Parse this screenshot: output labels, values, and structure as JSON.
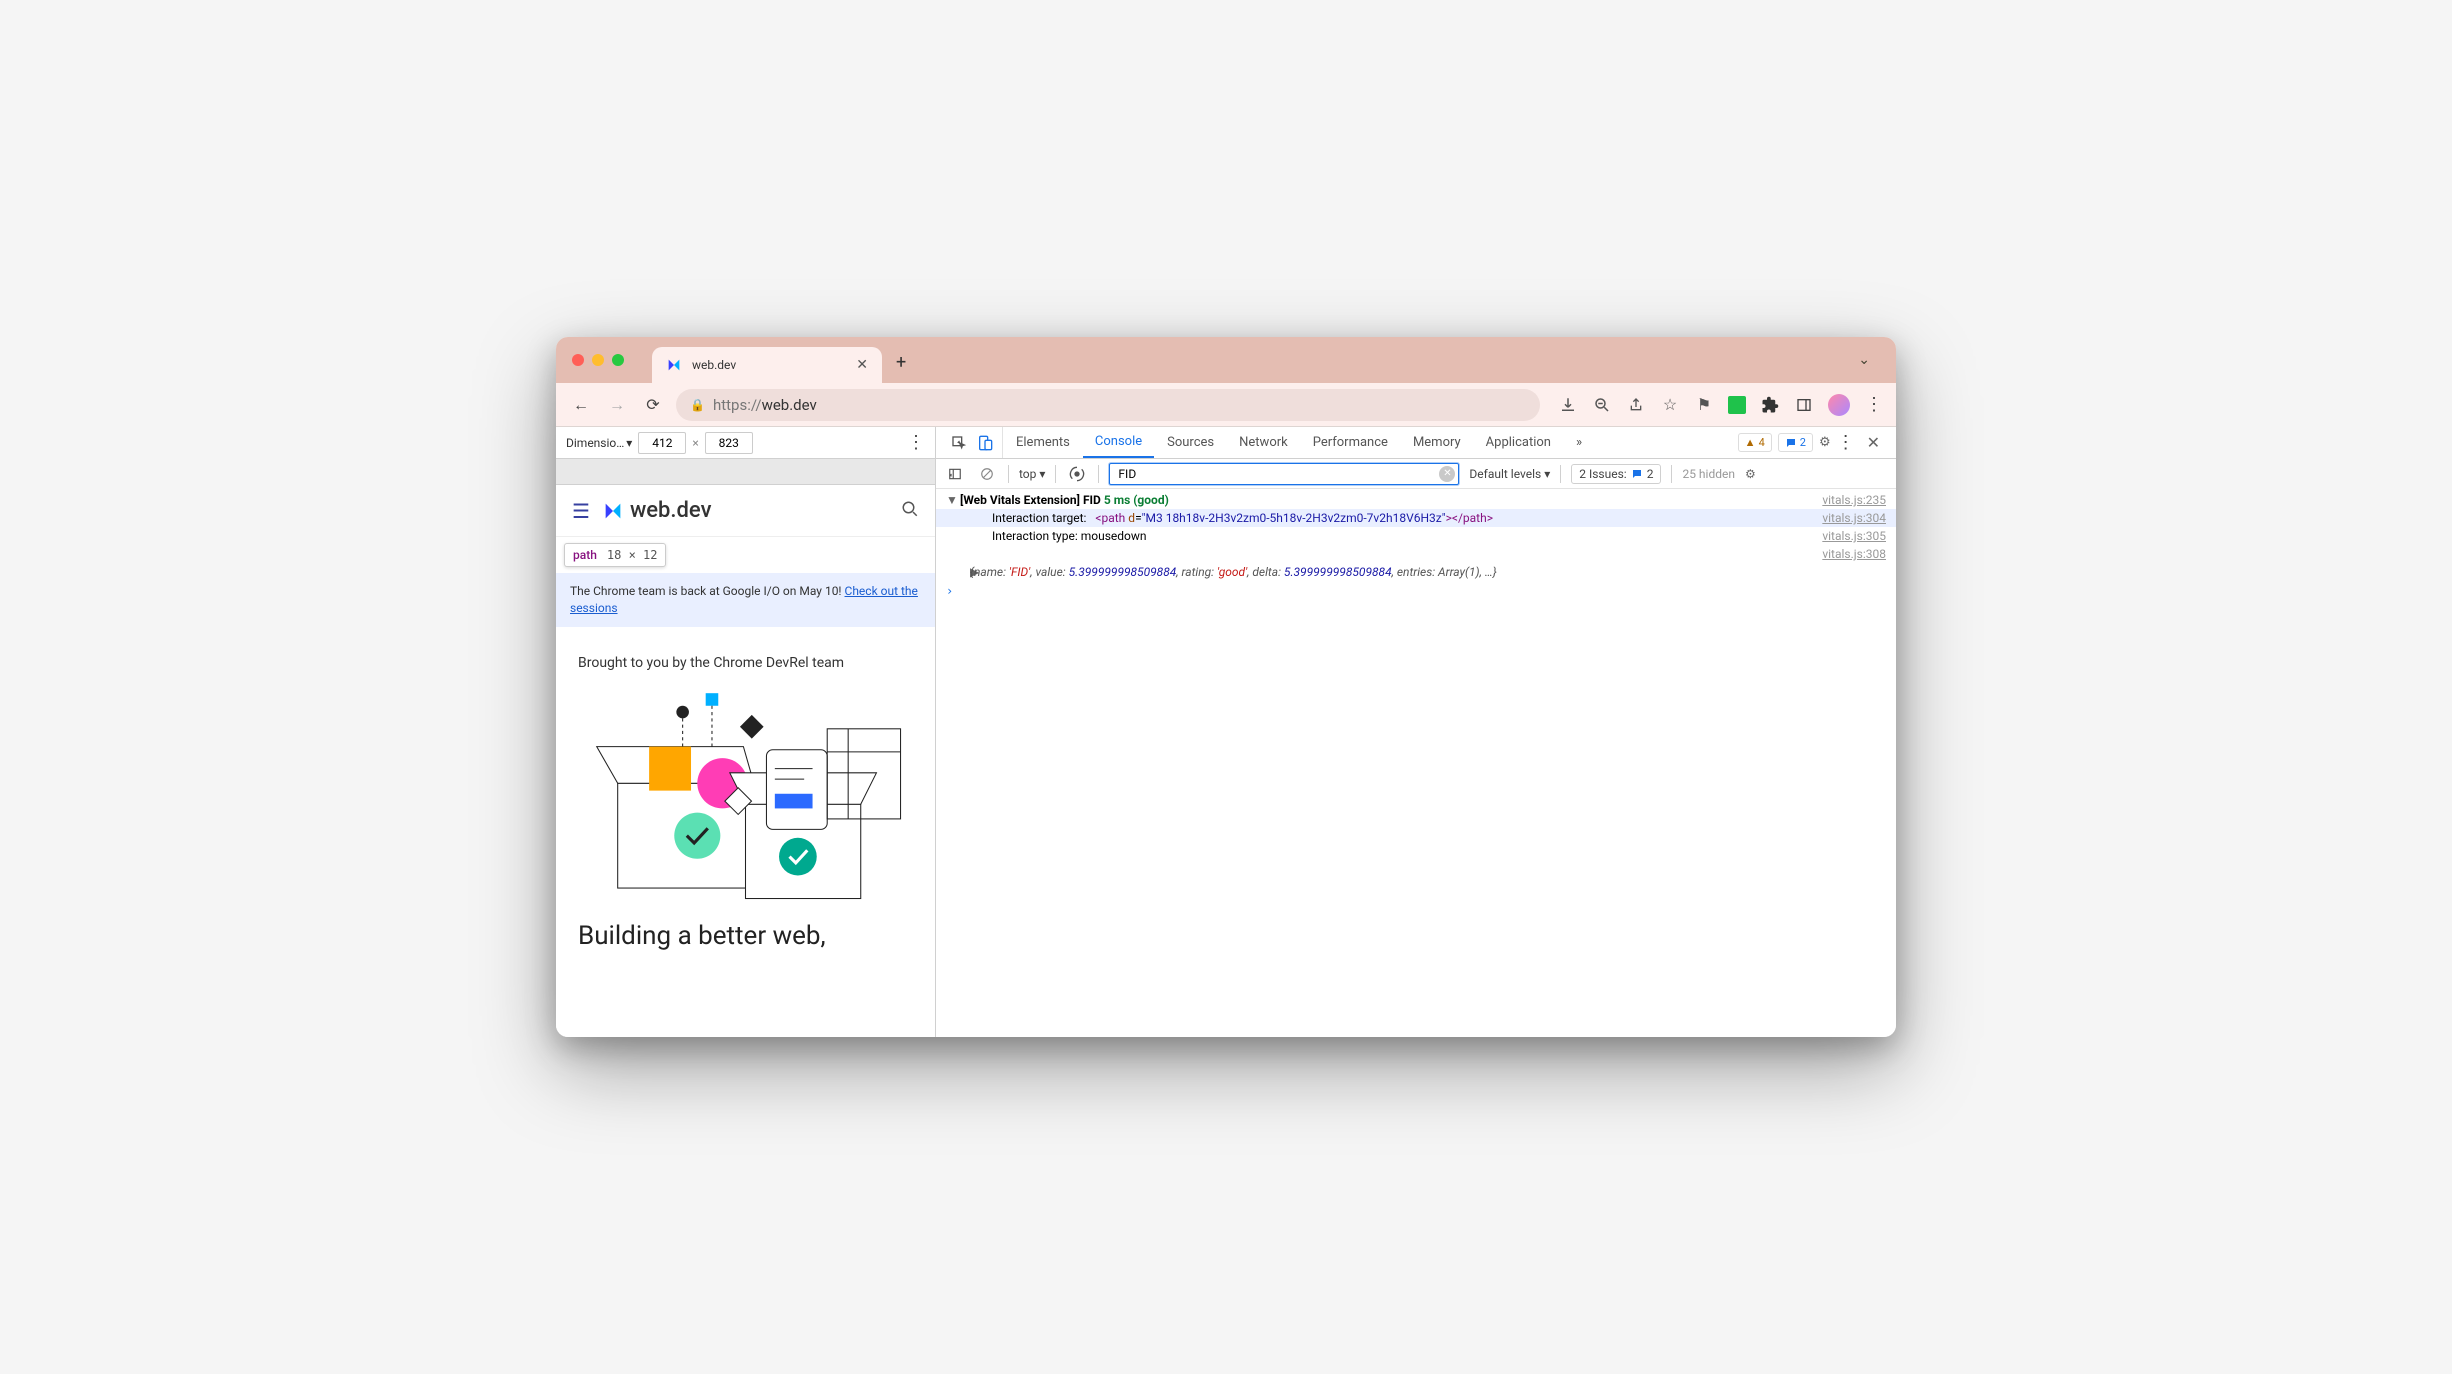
{
  "browser": {
    "tab_title": "web.dev",
    "new_tab_glyph": "+",
    "url_scheme": "https://",
    "url_host": "web.dev"
  },
  "device": {
    "label": "Dimensio…",
    "width": "412",
    "height": "823",
    "times": "×"
  },
  "tooltip": {
    "name": "path",
    "size": "18 × 12"
  },
  "site": {
    "brand": "web.dev",
    "banner_pre": "The Chrome team is back at Google I/O on May 10! ",
    "banner_link": "Check out the sessions",
    "lead": "Brought to you by the Chrome DevRel team",
    "headline": "Building a better web,"
  },
  "devtools": {
    "tabs": [
      "Elements",
      "Console",
      "Sources",
      "Network",
      "Performance",
      "Memory",
      "Application"
    ],
    "active_tab": "Console",
    "more": "»",
    "warn_count": "4",
    "info_count": "2",
    "context": "top",
    "filter_value": "FID",
    "levels": "Default levels",
    "issues_label": "2 Issues:",
    "issues_count": "2",
    "hidden": "25 hidden"
  },
  "console": {
    "rows": [
      {
        "disc": "▼",
        "prefix": "[Web Vitals Extension] FID",
        "metric": " 5 ms (good)",
        "src": "vitals.js:235"
      },
      {
        "indent": true,
        "highlighted": true,
        "label": "Interaction target:",
        "html_tag": "<path ",
        "html_attr": "d",
        "html_eq": "=",
        "html_val": "\"M3 18h18v-2H3v2zm0-5h18v-2H3v2zm0-7v2h18V6H3z\"",
        "html_close": "></path>",
        "src": "vitals.js:304"
      },
      {
        "indent": true,
        "label": "Interaction type:",
        "value": " mousedown",
        "src": "vitals.js:305"
      },
      {
        "src_only": true,
        "src": "vitals.js:308"
      },
      {
        "indent": true,
        "obj": true,
        "disc": "▶",
        "text": "{name: 'FID', value: 5.399999998509884, rating: 'good', delta: 5.399999998509884, entries: Array(1), …}"
      }
    ],
    "prompt": "›"
  }
}
